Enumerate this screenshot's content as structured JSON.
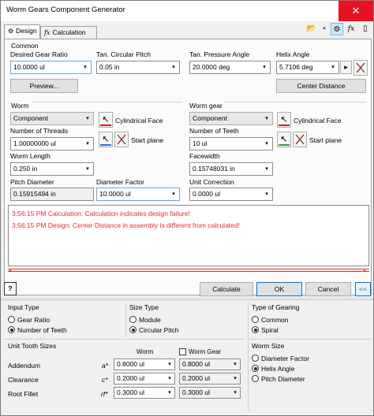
{
  "window": {
    "title": "Worm Gears Component Generator",
    "close_glyph": "✕"
  },
  "tabs": [
    {
      "label": "Design"
    },
    {
      "label": "Calculation"
    }
  ],
  "common": {
    "title": "Common",
    "gear_ratio_label": "Desired Gear Ratio",
    "gear_ratio_value": "10.0000 ul",
    "pitch_label": "Tan. Circular Pitch",
    "pitch_value": "0.05 in",
    "pressure_label": "Tan. Pressure Angle",
    "pressure_value": "20.0000 deg",
    "helix_label": "Helix Angle",
    "helix_value": "5.7106 deg",
    "preview_label": "Preview...",
    "center_distance_label": "Center Distance"
  },
  "worm": {
    "title": "Worm",
    "type_value": "Component",
    "cyl_label": "Cylindrical Face",
    "threads_label": "Number of Threads",
    "threads_value": "1.00000000 ul",
    "start_label": "Start plane",
    "length_label": "Worm Length",
    "length_value": "0.250 in",
    "pitch_dia_label": "Pitch Diameter",
    "pitch_dia_value": "0.15915494 in",
    "dia_factor_label": "Diameter Factor",
    "dia_factor_value": "10.0000 ul"
  },
  "worm_gear": {
    "title": "Worm gear",
    "type_value": "Component",
    "cyl_label": "Cylindrical Face",
    "teeth_label": "Number of Teeth",
    "teeth_value": "10 ul",
    "start_label": "Start plane",
    "facewidth_label": "Facewidth",
    "facewidth_value": "0.15748031 in",
    "correction_label": "Unit Correction",
    "correction_value": "0.0000 ul"
  },
  "messages": [
    "3:56:15 PM Calculation: Calculation indicates design failure!",
    "3:56:15 PM Design: Center Distance in assembly is different from calculated!"
  ],
  "buttons": {
    "help": "?",
    "calculate": "Calculate",
    "ok": "OK",
    "cancel": "Cancel",
    "collapse": "<<"
  },
  "input_type": {
    "title": "Input Type",
    "options": [
      "Gear Ratio",
      "Number of Teeth"
    ],
    "selected": 1
  },
  "size_type": {
    "title": "Size Type",
    "options": [
      "Module",
      "Circular Pitch"
    ],
    "selected": 1
  },
  "gearing_type": {
    "title": "Type of Gearing",
    "options": [
      "Common",
      "Spiral"
    ],
    "selected": 1
  },
  "tooth_sizes": {
    "title": "Unit Tooth Sizes",
    "col_worm": "Worm",
    "col_worm_gear": "Worm Gear",
    "rows": [
      {
        "label": "Addendum",
        "symbol": "a*",
        "worm": "0.8000 ul",
        "gear": "0.8000 ul"
      },
      {
        "label": "Clearance",
        "symbol": "c*",
        "worm": "0.2000 ul",
        "gear": "0.2000 ul"
      },
      {
        "label": "Root Fillet",
        "symbol": "rf*",
        "worm": "0.3000 ul",
        "gear": "0.3000 ul"
      }
    ]
  },
  "worm_size": {
    "title": "Worm Size",
    "options": [
      "Diameter Factor",
      "Helix Angle",
      "Pitch Diameter"
    ],
    "selected": 1
  }
}
